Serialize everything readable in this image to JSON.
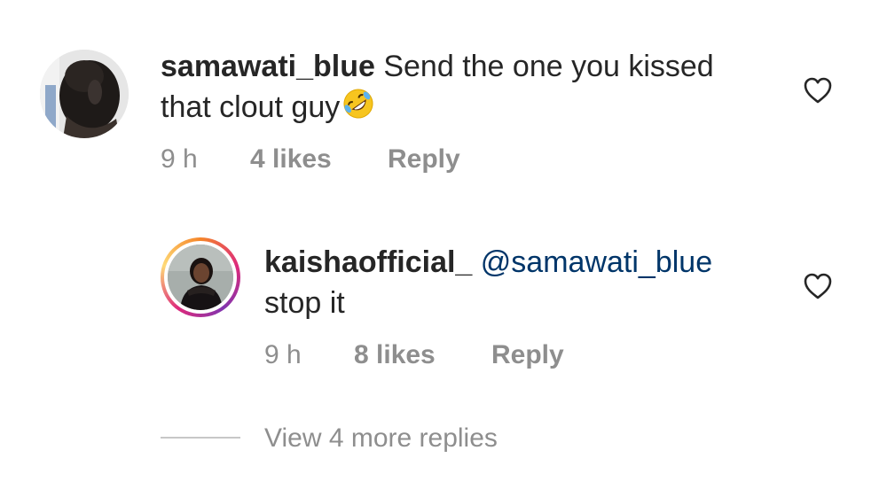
{
  "comments": [
    {
      "username": "samawati_blue",
      "text": "Send the one you kissed that clout guy",
      "emoji": "rolling-on-floor-laughing-emoji",
      "time": "9 h",
      "likes": "4 likes",
      "reply_label": "Reply",
      "like_icon": "heart-outline-icon"
    },
    {
      "username": "kaishaofficial_",
      "mention": "@samawati_blue",
      "text": "stop it",
      "time": "9 h",
      "likes": "8 likes",
      "reply_label": "Reply",
      "like_icon": "heart-outline-icon",
      "story_ring": true
    }
  ],
  "view_more_replies": "View 4 more replies",
  "colors": {
    "text": "#262626",
    "meta": "#8e8e8e",
    "mention": "#003569",
    "divider": "#c7c7c7",
    "background": "#ffffff"
  }
}
